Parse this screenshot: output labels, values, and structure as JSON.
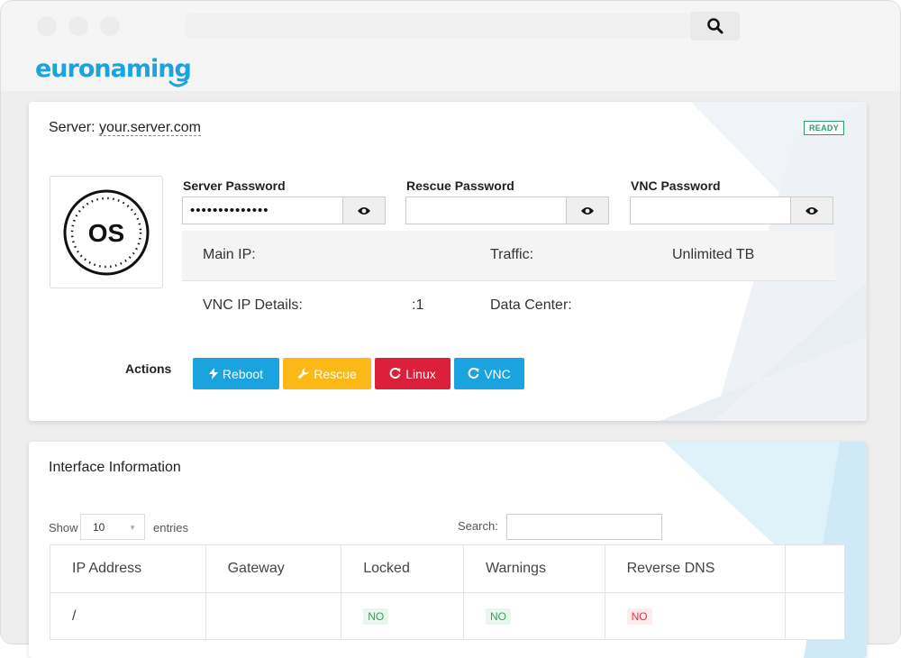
{
  "browser": {
    "logo_text": "euronaming"
  },
  "server": {
    "title_prefix": "Server: ",
    "hostname": "your.server.com",
    "status": "READY",
    "os_label": "OS",
    "passwords": [
      {
        "label": "Server Password",
        "value": "••••••••••••••"
      },
      {
        "label": "Rescue Password",
        "value": ""
      },
      {
        "label": "VNC Password",
        "value": ""
      }
    ],
    "details": {
      "main_ip_label": "Main IP:",
      "main_ip_value": "",
      "traffic_label": "Traffic:",
      "traffic_value": "Unlimited TB",
      "vnc_label": "VNC IP Details:",
      "vnc_value": ":1",
      "datacenter_label": "Data Center:",
      "datacenter_value": ""
    },
    "actions": {
      "label": "Actions",
      "reboot": "Reboot",
      "rescue": "Rescue",
      "linux": "Linux",
      "vnc": "VNC"
    }
  },
  "interfaces": {
    "title": "Interface Information",
    "show_label": "Show",
    "page_size": "10",
    "entries_label": "entries",
    "search_label": "Search:",
    "columns": [
      "IP Address",
      "Gateway",
      "Locked",
      "Warnings",
      "Reverse DNS",
      ""
    ],
    "rows": [
      {
        "ip": "/",
        "gateway": "",
        "locked": "NO",
        "warnings": "NO",
        "rdns": "NO"
      }
    ]
  },
  "colors": {
    "brand": "#1aa3df",
    "reboot": "#1aa3df",
    "rescue": "#fbb817",
    "linux": "#dc1f3a",
    "vnc": "#1aa3df",
    "ready": "#2f9e6a"
  },
  "icons": {
    "search": "search-icon",
    "eye": "eye-icon",
    "reboot": "bolt-icon",
    "rescue": "wrench-icon",
    "linux": "refresh-icon",
    "vnc": "refresh-icon"
  }
}
